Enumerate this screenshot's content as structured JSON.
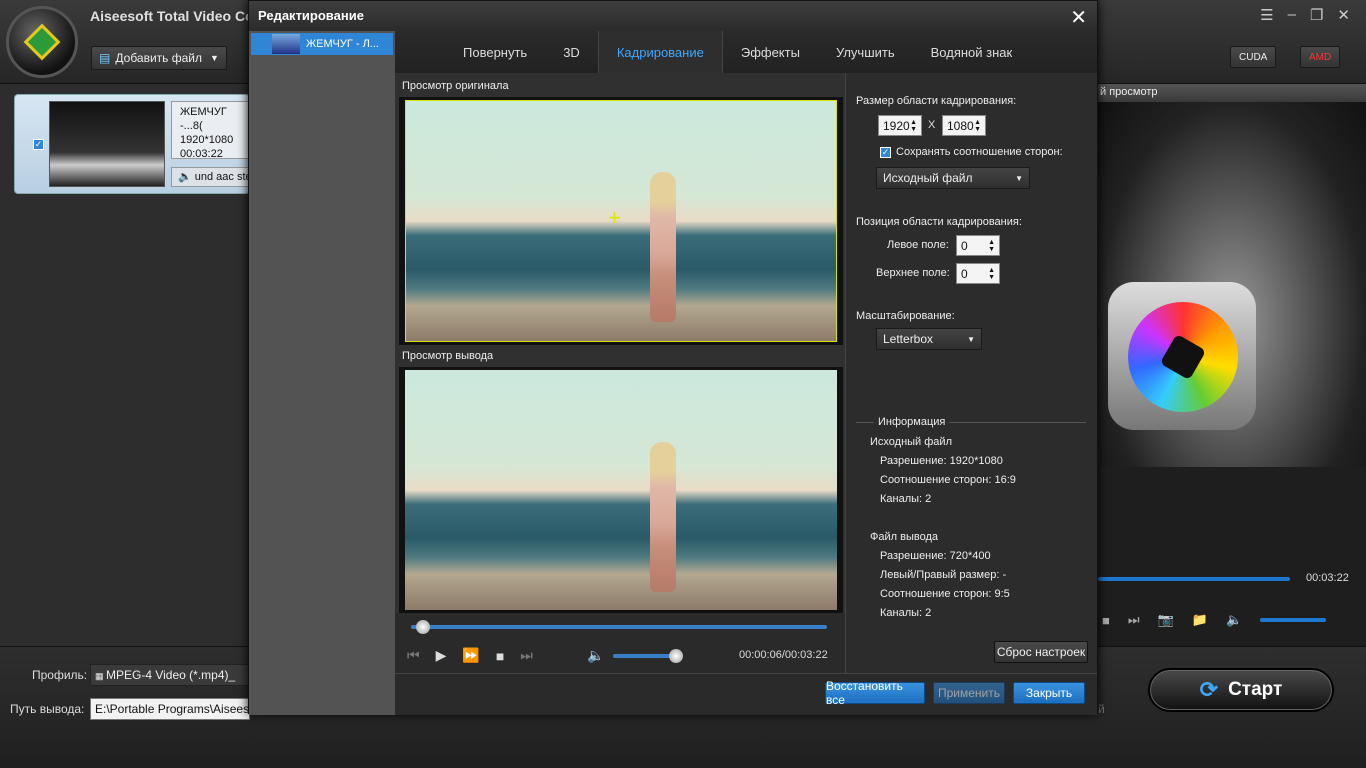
{
  "app": {
    "title": "Aiseesoft Total Video Co"
  },
  "toolbar": {
    "add_file": "Добавить файл",
    "cuda": "CUDA",
    "amd": "AMD"
  },
  "file_item": {
    "name": "ЖЕМЧУГ -...8(",
    "resolution": "1920*1080",
    "duration": "00:03:22",
    "audio": "und aac ste"
  },
  "right_panel": {
    "header": "й просмотр",
    "time": "00:03:22"
  },
  "bottom": {
    "profile_label": "Профиль:",
    "profile_value": "MPEG-4 Video (*.mp4)_",
    "output_label": "Путь вывода:",
    "output_value": "E:\\Portable Programs\\Aiseesoft",
    "trailing": "й",
    "start": "Старт"
  },
  "dialog": {
    "title": "Редактирование",
    "side_item": "ЖЕМЧУГ - Л...",
    "tabs": [
      "Повернуть",
      "3D",
      "Кадрирование",
      "Эффекты",
      "Улучшить",
      "Водяной знак"
    ],
    "active_tab": 2,
    "preview_original": "Просмотр оригинала",
    "preview_output": "Просмотр вывода",
    "time": "00:00:06/00:03:22",
    "progress": 0.03,
    "volume": 0.9
  },
  "crop": {
    "size_label": "Размер области кадрирования:",
    "width": "1920",
    "x": "X",
    "height": "1080",
    "keep_ratio": "Сохранять соотношение сторон:",
    "ratio_value": "Исходный файл",
    "position_label": "Позиция области кадрирования:",
    "left_label": "Левое поле:",
    "left_value": "0",
    "top_label": "Верхнее поле:",
    "top_value": "0",
    "scale_label": "Масштабирование:",
    "scale_value": "Letterbox"
  },
  "info": {
    "title": "Информация",
    "source_title": "Исходный файл",
    "src_res": "Разрешение: 1920*1080",
    "src_ratio": "Соотношение сторон: 16:9",
    "src_channels": "Каналы: 2",
    "out_title": "Файл вывода",
    "out_res": "Разрешение: 720*400",
    "out_lr": "Левый/Правый размер: -",
    "out_ratio": "Соотношение сторон: 9:5",
    "out_channels": "Каналы: 2",
    "reset": "Сброс настроек"
  },
  "footer": {
    "restore_all": "Восстановить все",
    "apply": "Применить",
    "close": "Закрыть"
  }
}
